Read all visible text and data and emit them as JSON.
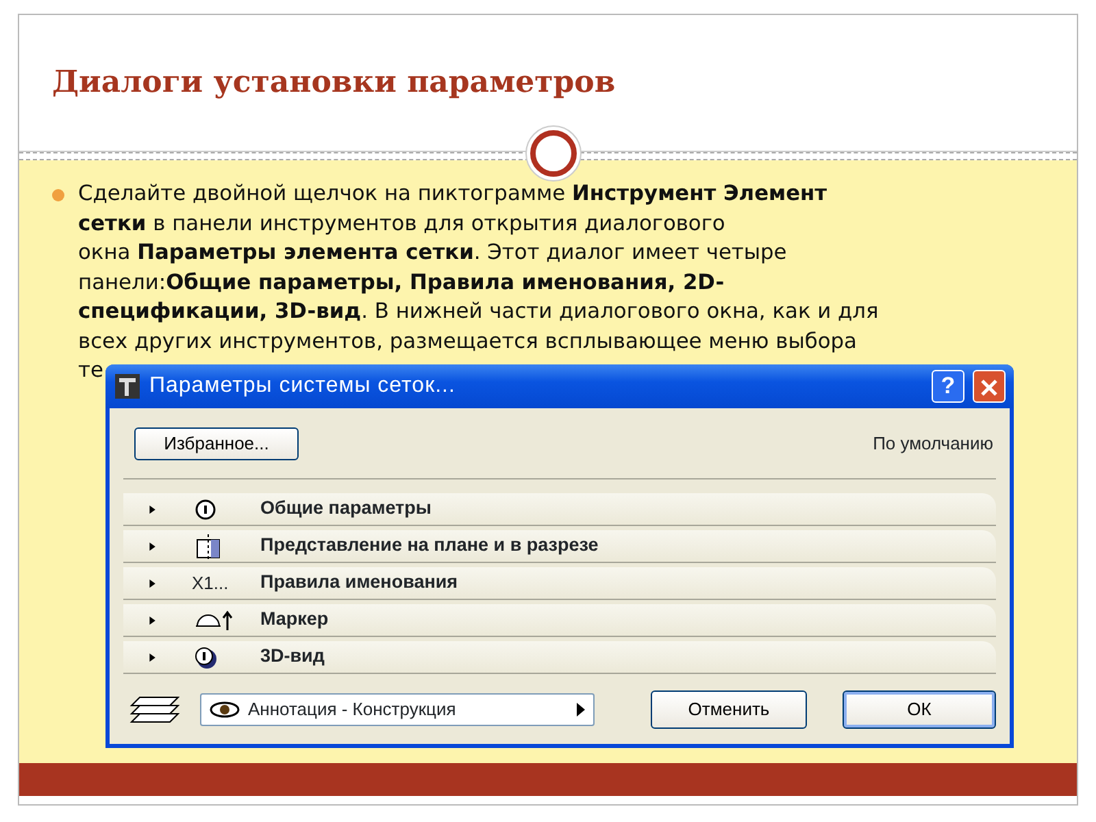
{
  "slide": {
    "title": "Диалоги установки параметров",
    "bullet_lines": [
      "Сделайте двойной щелчок на пиктограмме **Инструмент Элемент**",
      "**сетки** в панели инструментов для открытия диалогового",
      "окна **Параметры элемента сетки**. Этот диалог имеет четыре",
      "панели:**Общие параметры, Правила именования, 2D-**",
      "**спецификации, 3D-вид**. В нижней части диалогового окна, как и для",
      "всех других инструментов, размещается всплывающее меню выбора",
      "те"
    ]
  },
  "dialog": {
    "title": "Параметры системы сеток...",
    "help_button": "?",
    "favorites_button": "Избранное...",
    "default_label": "По умолчанию",
    "panels": [
      {
        "label": "Общие параметры",
        "kind": "general",
        "expanded": false
      },
      {
        "label": "Представление на плане и в разрезе",
        "kind": "plan",
        "expanded": false
      },
      {
        "label": "Правила именования",
        "kind": "naming",
        "icon_text": "X1...",
        "expanded": false
      },
      {
        "label": "Маркер",
        "kind": "marker",
        "expanded": false
      },
      {
        "label": "3D-вид",
        "kind": "solid",
        "expanded": false
      }
    ],
    "layer_select": "Аннотация - Конструкция",
    "buttons": [
      "Отменить",
      "ОК"
    ]
  }
}
